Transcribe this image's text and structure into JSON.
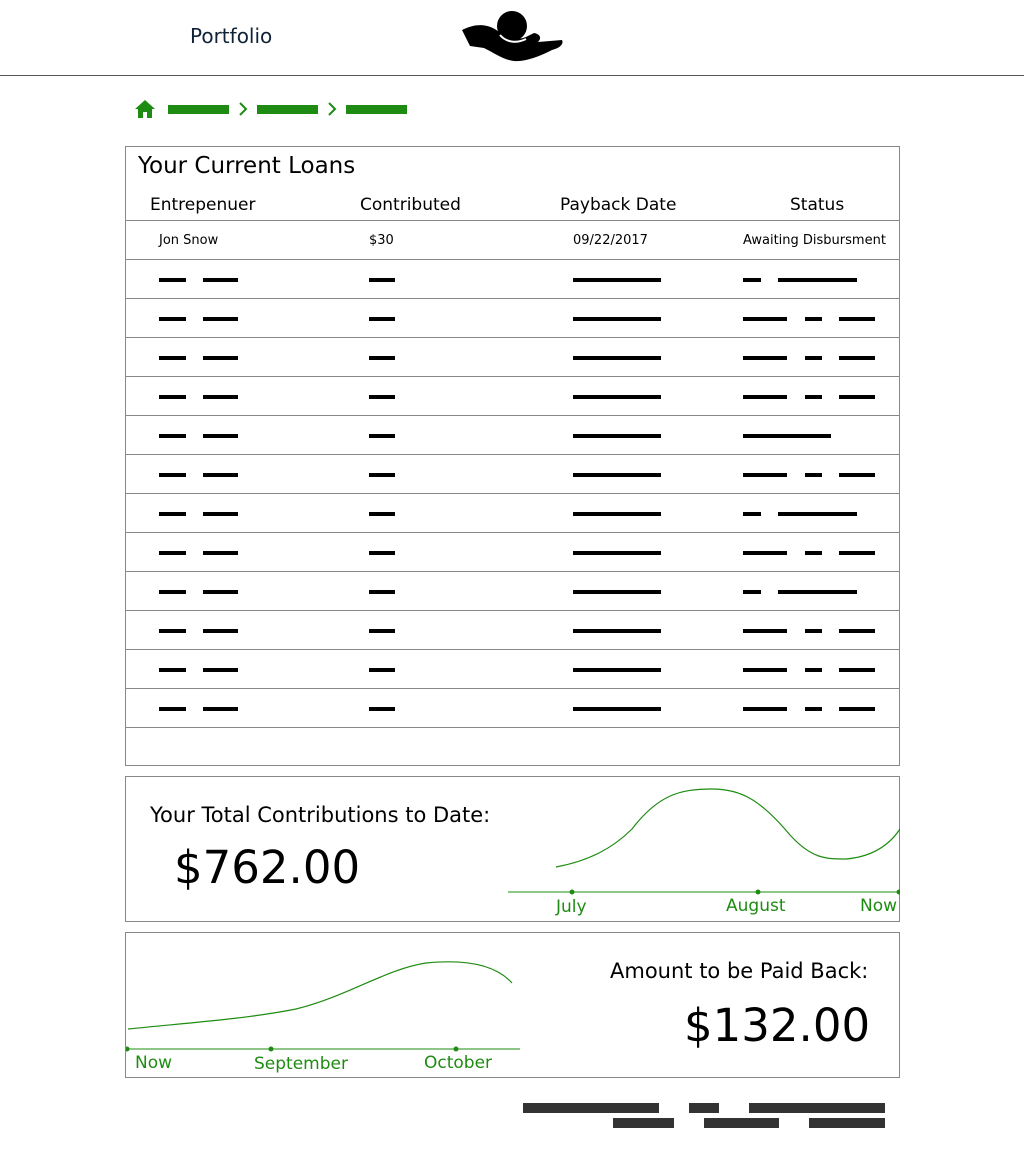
{
  "header": {
    "nav_title": "Portfolio",
    "logo_icon": "hand-holding-coin-icon"
  },
  "breadcrumb": {
    "home_icon": "home-icon",
    "separator_icon": "chevron-right-icon",
    "accent_color": "#1e8c12"
  },
  "loans": {
    "title": "Your Current Loans",
    "columns": [
      "Entrepenuer",
      "Contributed",
      "Payback Date",
      "Status"
    ],
    "first_row": {
      "entrepreneur": "Jon Snow",
      "contributed": "$30",
      "payback_date": "09/22/2017",
      "status": "Awaiting Disbursment"
    },
    "placeholder_status_variants": [
      "short-long",
      "three-part",
      "three-part",
      "three-part",
      "single",
      "three-part",
      "short-long",
      "three-part",
      "short-long",
      "three-part",
      "three-part",
      "three-part"
    ]
  },
  "contributions": {
    "label": "Your Total Contributions to Date:",
    "value": "$762.00",
    "x_labels": [
      "July",
      "August",
      "Now"
    ]
  },
  "payback": {
    "label": "Amount to be Paid Back:",
    "value": "$132.00",
    "x_labels": [
      "Now",
      "September",
      "October"
    ]
  },
  "colors": {
    "accent": "#1e8c12",
    "text": "#000000",
    "border": "#888888"
  }
}
